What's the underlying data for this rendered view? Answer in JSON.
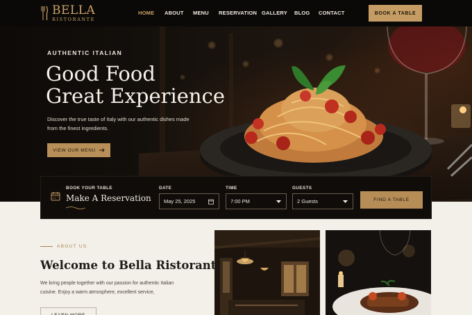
{
  "brand": {
    "name": "BELLA",
    "sub": "RISTORANTE"
  },
  "nav": {
    "items": [
      {
        "label": "HOME",
        "active": true
      },
      {
        "label": "ABOUT",
        "active": false
      },
      {
        "label": "MENU",
        "active": false
      },
      {
        "label": "RESERVATION",
        "active": false
      },
      {
        "label": "GALLERY",
        "active": false
      },
      {
        "label": "BLOG",
        "active": false
      },
      {
        "label": "CONTACT",
        "active": false
      }
    ],
    "book_label": "BOOK A TABLE"
  },
  "hero": {
    "eyebrow": "AUTHENTIC ITALIAN",
    "title_line1": "Good Food",
    "title_line2": "Great Experience",
    "desc": "Discover the true taste of Italy with our authentic dishes made from the finest ingredients.",
    "cta_label": "VIEW OUR MENU"
  },
  "reservation": {
    "small": "BOOK YOUR TABLE",
    "title": "Make A Reservation",
    "date_label": "DATE",
    "date_value": "May 25, 2025",
    "time_label": "TIME",
    "time_value": "7:00 PM",
    "guests_label": "GUESTS",
    "guests_value": "2 Guests",
    "find_label": "FIND A TABLE"
  },
  "about": {
    "eyebrow": "ABOUT US",
    "title": "Welcome to Bella Ristorante",
    "desc": "We bring people together with our passion for authentic Italian cuisine. Enjoy a warm atmosphere, excellent service,",
    "button_label": "LEARN MORE"
  },
  "colors": {
    "gold": "#c59c63",
    "dark": "#0b0907",
    "cream": "#f3efe9"
  }
}
